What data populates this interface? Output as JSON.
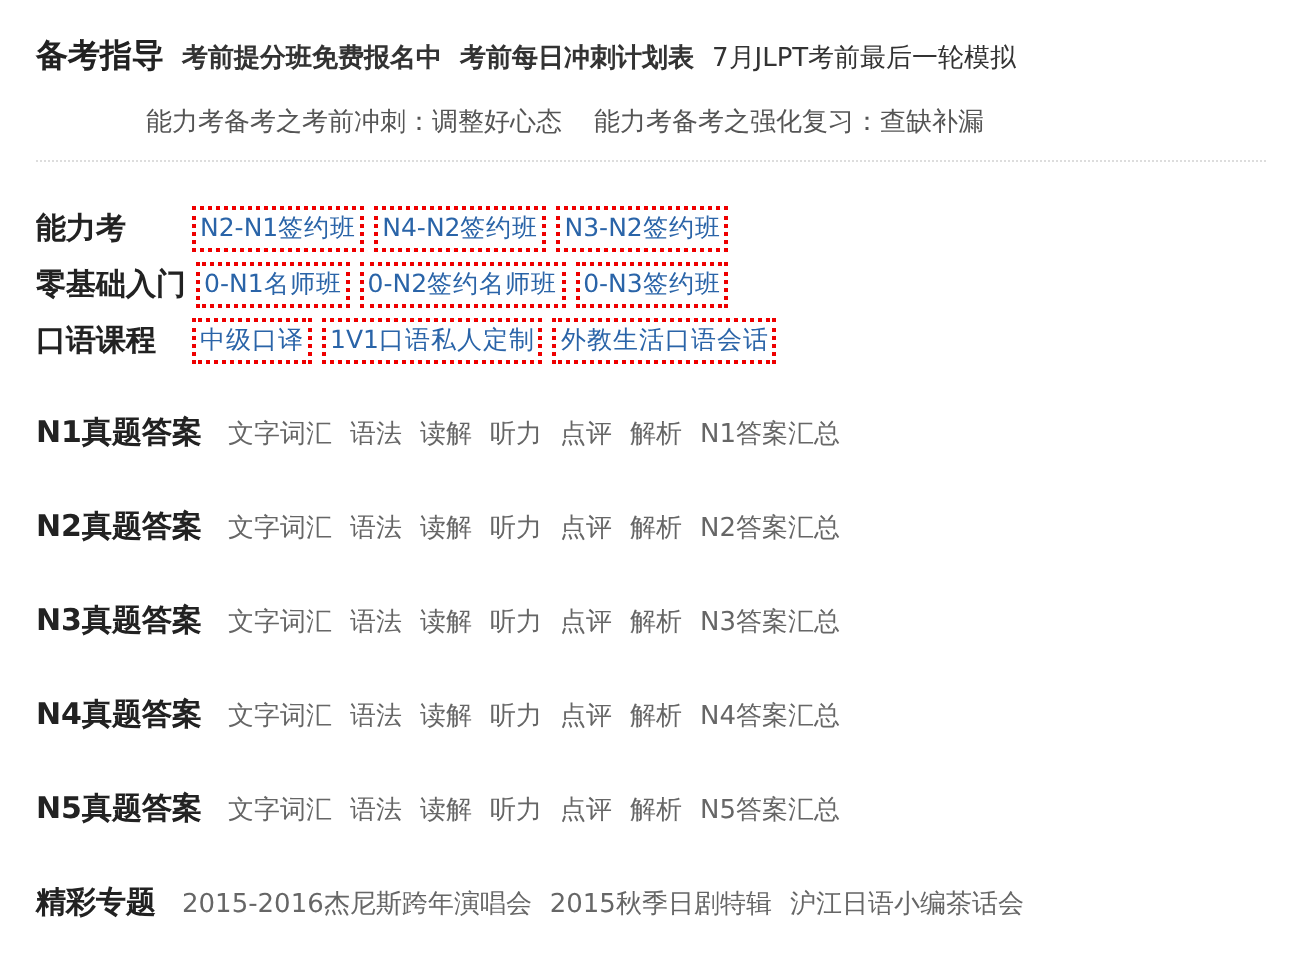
{
  "guide": {
    "title": "备考指导",
    "links": [
      {
        "text": "考前提分班免费报名中",
        "bold": true
      },
      {
        "text": "考前每日冲刺计划表",
        "bold": true
      },
      {
        "text": "7月JLPT考前最后一轮模拟",
        "bold": false
      }
    ],
    "sublinks": [
      "能力考备考之考前冲刺：调整好心态",
      "能力考备考之强化复习：查缺补漏"
    ]
  },
  "courses": [
    {
      "label": "能力考",
      "links": [
        "N2-N1签约班",
        "N4-N2签约班",
        "N3-N2签约班"
      ]
    },
    {
      "label": "零基础入门",
      "links": [
        "0-N1名师班",
        "0-N2签约名师班",
        "0-N3签约班"
      ]
    },
    {
      "label": "口语课程",
      "links": [
        "中级口译",
        "1V1口语私人定制",
        "外教生活口语会话"
      ]
    }
  ],
  "answers": [
    {
      "label": "N1真题答案",
      "links": [
        "文字词汇",
        "语法",
        "读解",
        "听力",
        "点评",
        "解析",
        "N1答案汇总"
      ]
    },
    {
      "label": "N2真题答案",
      "links": [
        "文字词汇",
        "语法",
        "读解",
        "听力",
        "点评",
        "解析",
        "N2答案汇总"
      ]
    },
    {
      "label": "N3真题答案",
      "links": [
        "文字词汇",
        "语法",
        "读解",
        "听力",
        "点评",
        "解析",
        "N3答案汇总"
      ]
    },
    {
      "label": "N4真题答案",
      "links": [
        "文字词汇",
        "语法",
        "读解",
        "听力",
        "点评",
        "解析",
        "N4答案汇总"
      ]
    },
    {
      "label": "N5真题答案",
      "links": [
        "文字词汇",
        "语法",
        "读解",
        "听力",
        "点评",
        "解析",
        "N5答案汇总"
      ]
    }
  ],
  "topics": {
    "label": "精彩专题",
    "links": [
      "2015-2016杰尼斯跨年演唱会",
      "2015秋季日剧特辑",
      "沪江日语小编茶话会"
    ]
  }
}
